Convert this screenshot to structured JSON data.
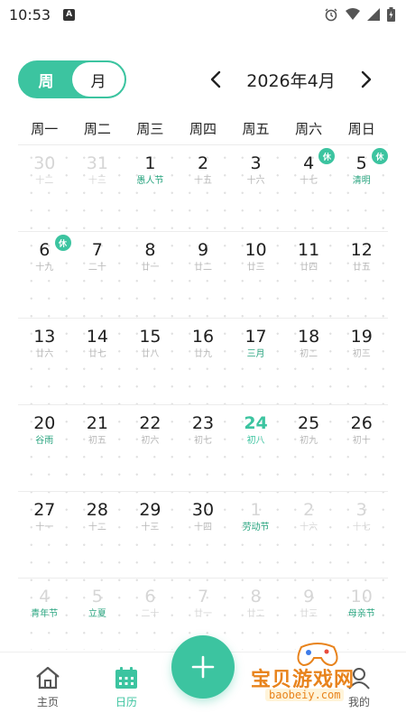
{
  "status_bar": {
    "time": "10:53",
    "a_icon": "A"
  },
  "view_toggle": {
    "week": "周",
    "month": "月",
    "active": "week"
  },
  "header": {
    "month_title": "2026年4月"
  },
  "weekdays": [
    "周一",
    "周二",
    "周三",
    "周四",
    "周五",
    "周六",
    "周日"
  ],
  "weeks": [
    [
      {
        "day": "30",
        "sub": "十二",
        "dim": true
      },
      {
        "day": "31",
        "sub": "十三",
        "dim": true
      },
      {
        "day": "1",
        "sub": "愚人节",
        "festival": true
      },
      {
        "day": "2",
        "sub": "十五"
      },
      {
        "day": "3",
        "sub": "十六"
      },
      {
        "day": "4",
        "sub": "十七",
        "badge": "休"
      },
      {
        "day": "5",
        "sub": "清明",
        "festival": true,
        "badge": "休"
      }
    ],
    [
      {
        "day": "6",
        "sub": "十九",
        "badge": "休"
      },
      {
        "day": "7",
        "sub": "二十"
      },
      {
        "day": "8",
        "sub": "廿一"
      },
      {
        "day": "9",
        "sub": "廿二"
      },
      {
        "day": "10",
        "sub": "廿三"
      },
      {
        "day": "11",
        "sub": "廿四"
      },
      {
        "day": "12",
        "sub": "廿五"
      }
    ],
    [
      {
        "day": "13",
        "sub": "廿六"
      },
      {
        "day": "14",
        "sub": "廿七"
      },
      {
        "day": "15",
        "sub": "廿八"
      },
      {
        "day": "16",
        "sub": "廿九"
      },
      {
        "day": "17",
        "sub": "三月",
        "festival": true
      },
      {
        "day": "18",
        "sub": "初二"
      },
      {
        "day": "19",
        "sub": "初三"
      }
    ],
    [
      {
        "day": "20",
        "sub": "谷雨",
        "festival": true
      },
      {
        "day": "21",
        "sub": "初五"
      },
      {
        "day": "22",
        "sub": "初六"
      },
      {
        "day": "23",
        "sub": "初七"
      },
      {
        "day": "24",
        "sub": "初八",
        "today": true
      },
      {
        "day": "25",
        "sub": "初九"
      },
      {
        "day": "26",
        "sub": "初十"
      }
    ],
    [
      {
        "day": "27",
        "sub": "十一"
      },
      {
        "day": "28",
        "sub": "十二"
      },
      {
        "day": "29",
        "sub": "十三"
      },
      {
        "day": "30",
        "sub": "十四"
      },
      {
        "day": "1",
        "sub": "劳动节",
        "dim": true,
        "festival": true
      },
      {
        "day": "2",
        "sub": "十六",
        "dim": true
      },
      {
        "day": "3",
        "sub": "十七",
        "dim": true
      }
    ],
    [
      {
        "day": "4",
        "sub": "青年节",
        "dim": true,
        "festival": true
      },
      {
        "day": "5",
        "sub": "立夏",
        "dim": true,
        "festival": true
      },
      {
        "day": "6",
        "sub": "二十",
        "dim": true
      },
      {
        "day": "7",
        "sub": "廿一",
        "dim": true
      },
      {
        "day": "8",
        "sub": "廿二",
        "dim": true
      },
      {
        "day": "9",
        "sub": "廿三",
        "dim": true
      },
      {
        "day": "10",
        "sub": "母亲节",
        "dim": true,
        "festival": true
      }
    ]
  ],
  "bottom_nav": {
    "home": "主页",
    "calendar": "日历",
    "mine": "我的",
    "active": "calendar"
  },
  "fab": {
    "icon": "plus-icon"
  },
  "watermark": {
    "title": "宝贝游戏网",
    "url": "baobeiy.com"
  },
  "colors": {
    "accent": "#3cc4a0",
    "festival": "#28a47f",
    "watermark": "#e8831c"
  }
}
